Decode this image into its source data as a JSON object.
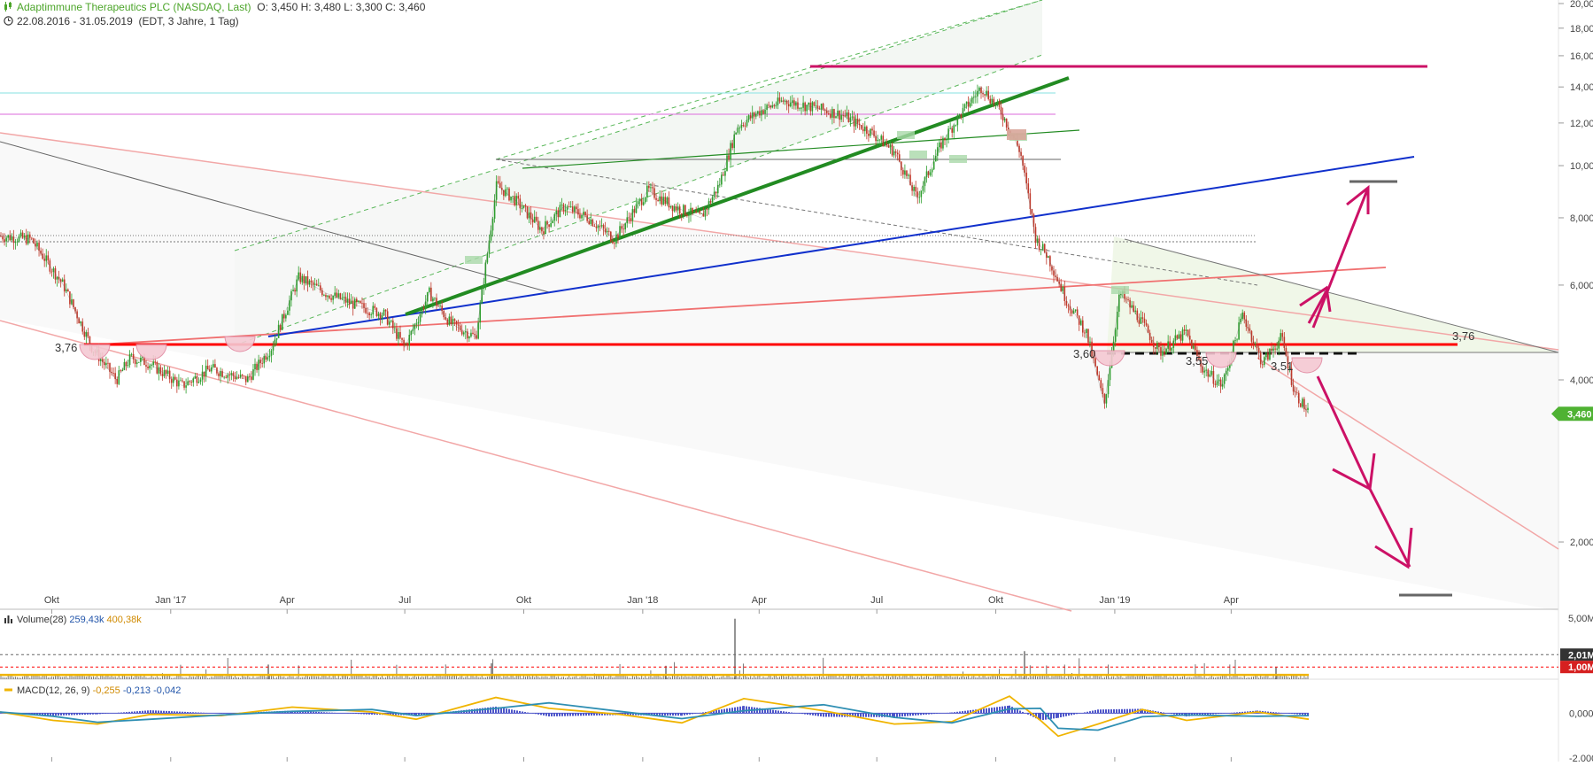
{
  "header": {
    "instrument": "Adaptimmune Therapeutics PLC (NASDAQ, Last)",
    "ohlc": "O: 3,450  H: 3,480  L: 3,300  C: 3,460",
    "range": "22.08.2016 - 31.05.2019",
    "meta": "(EDT, 3 Jahre, 1 Tag)"
  },
  "volume_header": {
    "label": "Volume(28)",
    "v1": "259,43k",
    "v2": "400,38k"
  },
  "macd_header": {
    "label": "MACD(12, 26, 9)",
    "v1": "-0,255",
    "v2": "-0,213",
    "v3": "-0,042"
  },
  "colors": {
    "up": "#2e9e2e",
    "down": "#c0392b",
    "support": "#ff0000",
    "resistance": "#cc1166",
    "trend_blue": "#1030cc",
    "trend_green": "#228b22",
    "price_tag": "#4fb233"
  },
  "chart_data": {
    "type": "line",
    "title": "Adaptimmune Therapeutics PLC (NASDAQ, Last)",
    "xlabel": "",
    "ylabel": "",
    "y_scale": "log",
    "ylim": [
      1.5,
      20
    ],
    "x_tick_labels": [
      "Okt",
      "Jan '17",
      "Apr",
      "Jul",
      "Okt",
      "Jan '18",
      "Apr",
      "Jul",
      "Okt",
      "Jan '19",
      "Apr"
    ],
    "y_tick_labels": [
      "20,000",
      "18,000",
      "16,000",
      "14,000",
      "12,000",
      "10,000",
      "8,000",
      "6,000",
      "4,000",
      "2,000"
    ],
    "y_tick_values": [
      20,
      18,
      16,
      14,
      12,
      10,
      8,
      6,
      4,
      2
    ],
    "last_price_label": "3,460",
    "support_labels": [
      "3,76",
      "3,60",
      "3,55",
      "3,51",
      "3,76"
    ],
    "series": [
      {
        "dates": [
          "2016-08-22",
          "2016-09-15",
          "2016-10-10",
          "2016-11-01",
          "2016-11-20",
          "2016-12-01",
          "2016-12-15",
          "2017-01-10",
          "2017-02-01",
          "2017-03-01",
          "2017-03-20",
          "2017-04-10",
          "2017-05-01",
          "2017-05-25",
          "2017-06-15",
          "2017-07-01",
          "2017-07-20",
          "2017-08-05",
          "2017-08-25",
          "2017-09-10",
          "2017-09-25",
          "2017-10-15",
          "2017-11-01",
          "2017-11-20",
          "2017-12-10",
          "2018-01-05",
          "2018-01-25",
          "2018-02-15",
          "2018-03-01",
          "2018-03-15",
          "2018-04-01",
          "2018-04-20",
          "2018-05-15",
          "2018-06-05",
          "2018-06-25",
          "2018-07-15",
          "2018-08-01",
          "2018-08-20",
          "2018-09-01",
          "2018-09-20",
          "2018-10-05",
          "2018-10-20",
          "2018-11-01",
          "2018-11-10",
          "2018-11-25",
          "2018-12-10",
          "2018-12-24",
          "2019-01-05",
          "2019-01-20",
          "2019-02-05",
          "2019-02-25",
          "2019-03-10",
          "2019-03-25",
          "2019-04-10",
          "2019-04-25",
          "2019-05-10",
          "2019-05-20",
          "2019-05-31"
        ],
        "close": [
          7.4,
          7.3,
          6.0,
          4.6,
          4.0,
          4.4,
          4.3,
          3.9,
          4.2,
          4.0,
          4.6,
          6.2,
          5.8,
          5.5,
          5.3,
          4.6,
          5.8,
          5.1,
          4.8,
          9.2,
          8.6,
          7.6,
          8.4,
          8.0,
          7.3,
          9.0,
          8.4,
          8.0,
          9.2,
          11.8,
          12.6,
          13.2,
          12.8,
          12.4,
          11.6,
          10.6,
          8.7,
          11.0,
          12.2,
          14.0,
          12.6,
          10.6,
          7.3,
          6.8,
          5.6,
          4.9,
          3.6,
          5.8,
          5.2,
          4.5,
          4.9,
          4.2,
          3.9,
          5.3,
          4.3,
          4.8,
          3.8,
          3.46
        ]
      }
    ],
    "volume": {
      "ylim": [
        0,
        5
      ],
      "y_tick_labels": [
        "5,00M",
        "2,01M",
        "1,00M"
      ]
    },
    "macd": {
      "ylim": [
        -2,
        1
      ],
      "y_tick_labels": [
        "0,000",
        "-2,000"
      ]
    }
  }
}
